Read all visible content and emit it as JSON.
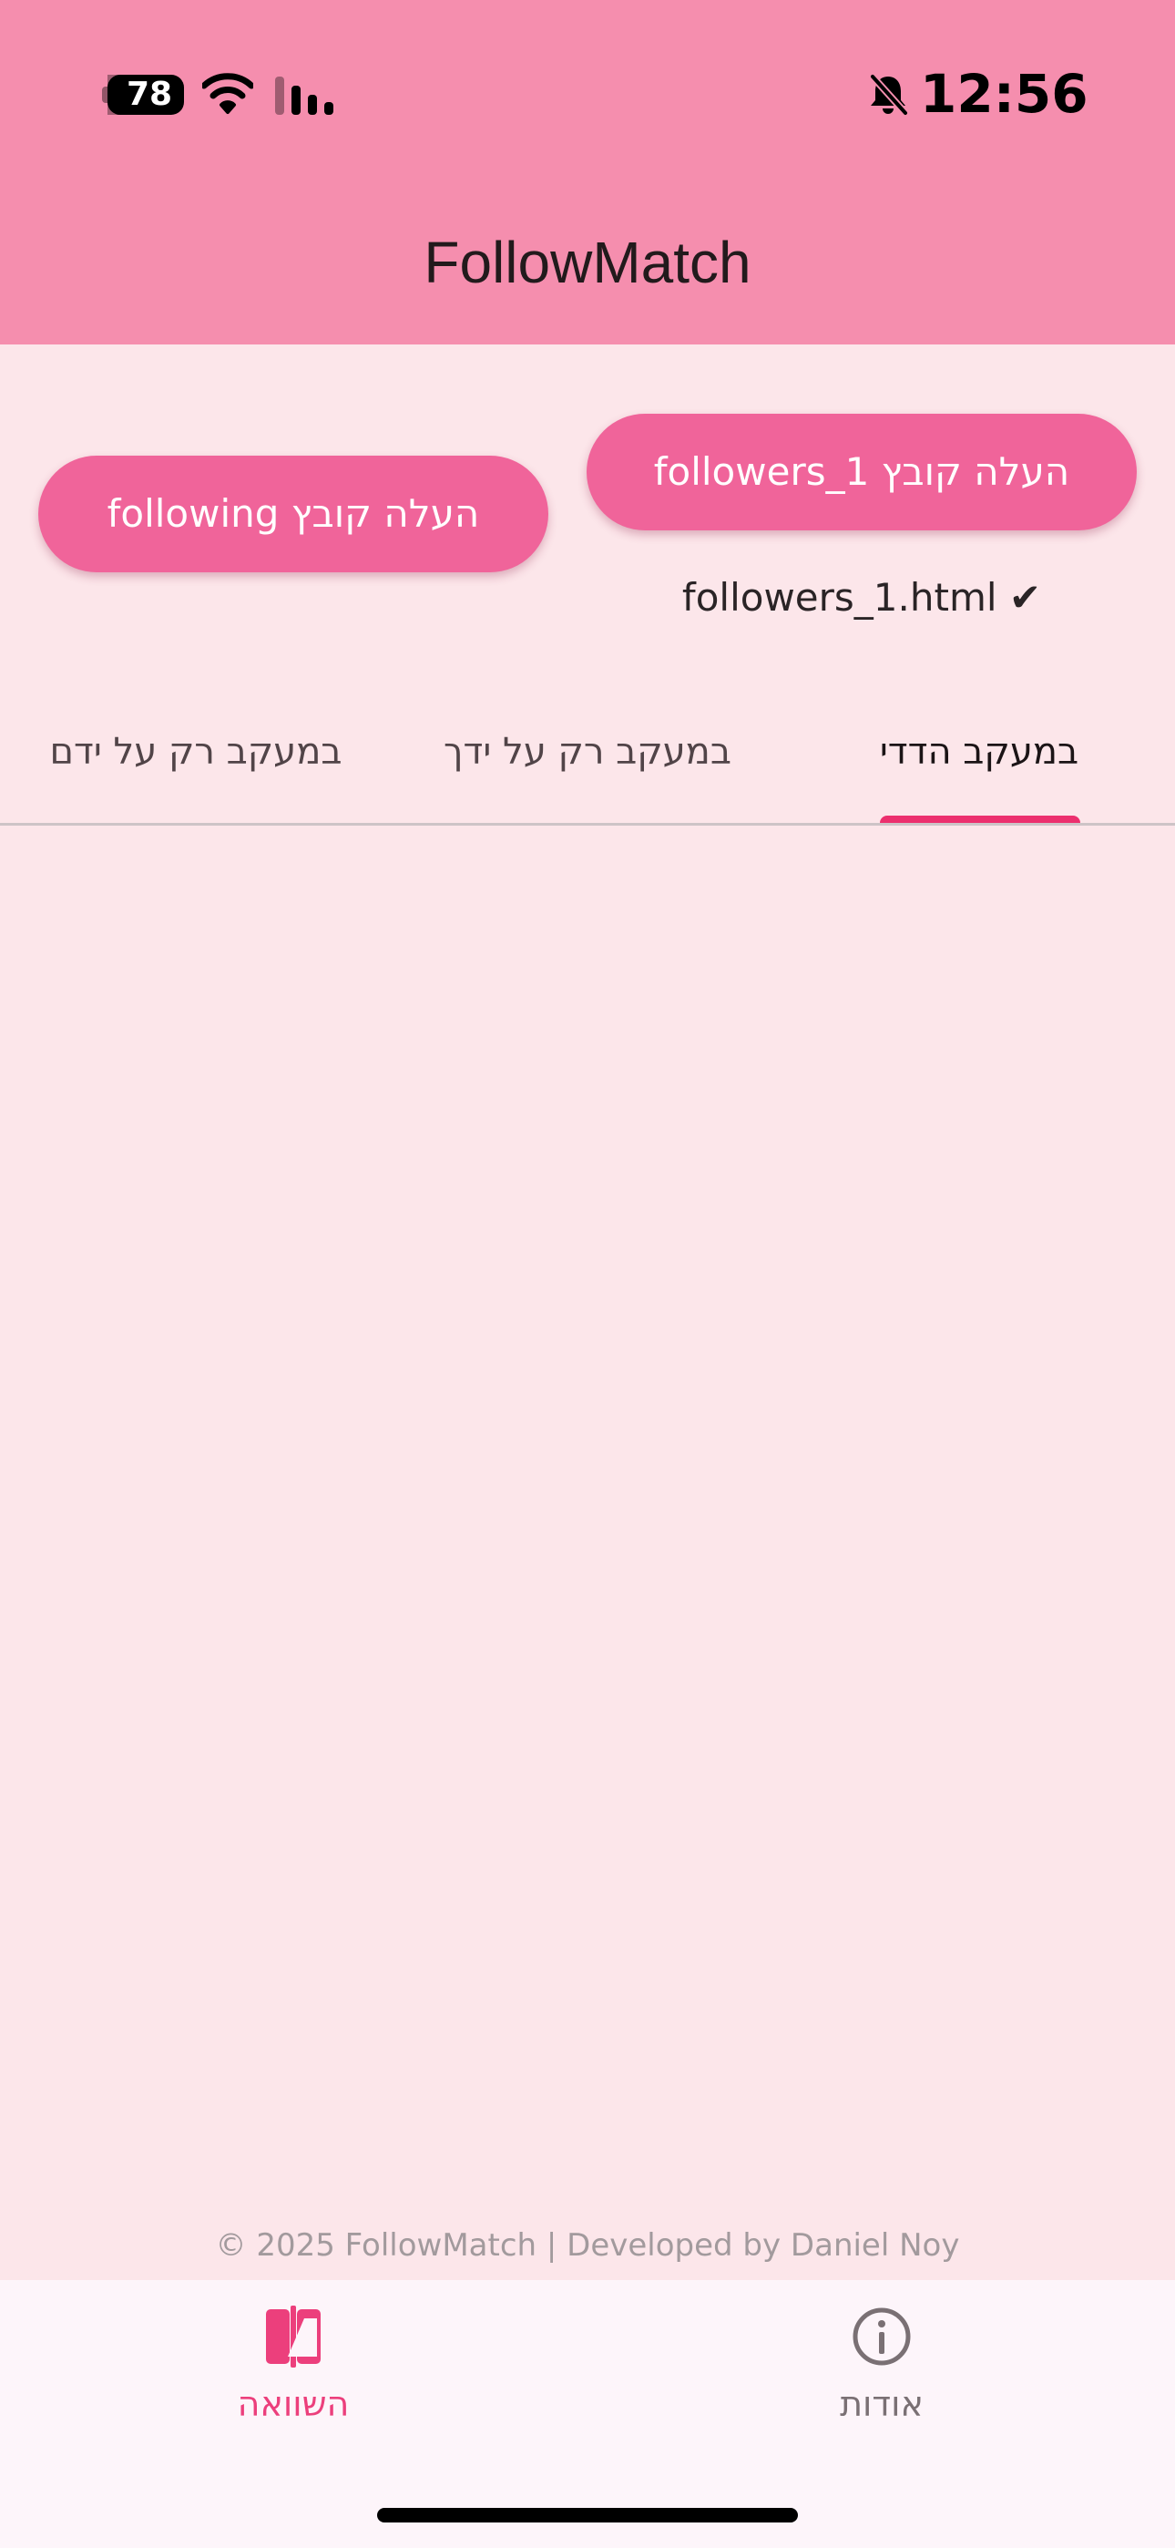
{
  "status_bar": {
    "battery_level": "78",
    "time": "12:56",
    "icons": [
      "battery-icon",
      "wifi-icon",
      "cellular-signal-icon",
      "bell-slash-icon"
    ]
  },
  "app_bar": {
    "title": "FollowMatch"
  },
  "upload": {
    "followers_button_label": "העלה קובץ followers_1",
    "following_button_label": "העלה קובץ following",
    "followers_file_status": "followers_1.html ✔"
  },
  "tabs": [
    {
      "label": "במעקב הדדי",
      "selected": true
    },
    {
      "label": "במעקב רק על ידך",
      "selected": false
    },
    {
      "label": "במעקב רק על ידם",
      "selected": false
    }
  ],
  "footer": {
    "text": "© 2025 FollowMatch | Developed by Daniel Noy"
  },
  "bottom_nav": {
    "items": [
      {
        "label": "השוואה",
        "icon": "compare-icon",
        "selected": true
      },
      {
        "label": "אודות",
        "icon": "info-icon",
        "selected": false
      }
    ]
  },
  "colors": {
    "app_bar": "#F58EAE",
    "background": "#FCE6EA",
    "button": "#F0649A",
    "accent": "#EC2F6E",
    "nav_background": "#FDF5FA"
  }
}
